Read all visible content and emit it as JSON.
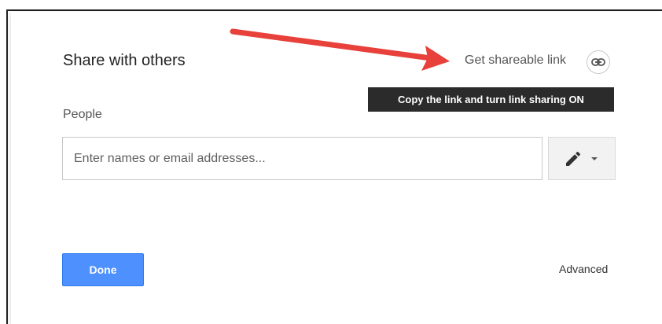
{
  "dialog": {
    "title": "Share with others",
    "get_link_label": "Get shareable link",
    "tooltip": "Copy the link and turn link sharing ON",
    "people_label": "People",
    "input": {
      "value": "",
      "placeholder": "Enter names or email addresses..."
    },
    "permission_icon": "pencil-icon",
    "done_label": "Done",
    "advanced_label": "Advanced"
  },
  "colors": {
    "done_button": "#4d90fe",
    "tooltip_bg": "#2b2b2b",
    "annotation_arrow": "#e8403a"
  }
}
